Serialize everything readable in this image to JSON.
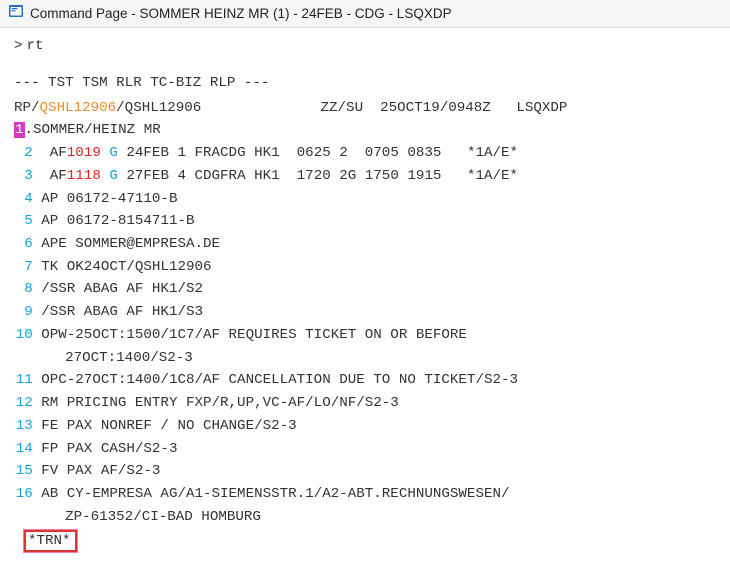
{
  "titlebar": {
    "title": "Command Page - SOMMER HEINZ MR (1) - 24FEB - CDG - LSQXDP"
  },
  "prompt": {
    "caret": ">",
    "command": "rt"
  },
  "flags_line": "--- TST TSM RLR TC-BIZ RLP ---",
  "header": {
    "prefix": "RP/",
    "office": "QSHL12906",
    "suffix": "/QSHL12906",
    "right": "ZZ/SU  25OCT19/0948Z   LSQXDP",
    "gap": "              "
  },
  "lines": [
    {
      "n": "1",
      "hl": true,
      "pre": ".",
      "body": "SOMMER/HEINZ MR"
    },
    {
      "n": "2",
      "pre": "  ",
      "air": {
        "carrier": "AF",
        "fno": "1019",
        "cls": "G",
        "rest": " 24FEB 1 FRACDG HK1  0625 2  0705 0835   *1A/E*"
      }
    },
    {
      "n": "3",
      "pre": "  ",
      "air": {
        "carrier": "AF",
        "fno": "1118",
        "cls": "G",
        "rest": " 27FEB 4 CDGFRA HK1  1720 2G 1750 1915   *1A/E*"
      }
    },
    {
      "n": "4",
      "pre": " ",
      "body": "AP 06172-47110-B"
    },
    {
      "n": "5",
      "pre": " ",
      "body": "AP 06172-8154711-B"
    },
    {
      "n": "6",
      "pre": " ",
      "body": "APE SOMMER@EMPRESA.DE"
    },
    {
      "n": "7",
      "pre": " ",
      "body": "TK OK24OCT/QSHL12906"
    },
    {
      "n": "8",
      "pre": " ",
      "body": "/SSR ABAG AF HK1/S2"
    },
    {
      "n": "9",
      "pre": " ",
      "body": "/SSR ABAG AF HK1/S3"
    },
    {
      "n": "10",
      "pre": " ",
      "body": "OPW-25OCT:1500/1C7/AF REQUIRES TICKET ON OR BEFORE",
      "cont": "27OCT:1400/S2-3"
    },
    {
      "n": "11",
      "pre": " ",
      "body": "OPC-27OCT:1400/1C8/AF CANCELLATION DUE TO NO TICKET/S2-3"
    },
    {
      "n": "12",
      "pre": " ",
      "body": "RM PRICING ENTRY FXP/R,UP,VC-AF/LO/NF/S2-3"
    },
    {
      "n": "13",
      "pre": " ",
      "body": "FE PAX NONREF / NO CHANGE/S2-3"
    },
    {
      "n": "14",
      "pre": " ",
      "body": "FP PAX CASH/S2-3"
    },
    {
      "n": "15",
      "pre": " ",
      "body": "FV PAX AF/S2-3"
    },
    {
      "n": "16",
      "pre": " ",
      "body": "AB CY-EMPRESA AG/A1-SIEMENSSTR.1/A2-ABT.RECHNUNGSWESEN/",
      "cont": "ZP-61352/CI-BAD HOMBURG"
    }
  ],
  "footer": {
    "trn": "*TRN*"
  }
}
